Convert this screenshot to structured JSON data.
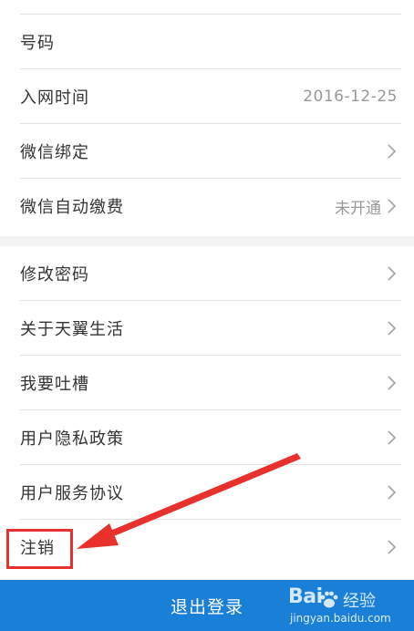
{
  "section1": {
    "rows": [
      {
        "label": "号码",
        "value": ""
      },
      {
        "label": "入网时间",
        "value": "2016-12-25"
      },
      {
        "label": "微信绑定",
        "value": ""
      },
      {
        "label": "微信自动缴费",
        "value": "未开通"
      }
    ]
  },
  "section2": {
    "rows": [
      {
        "label": "修改密码"
      },
      {
        "label": "关于天翼生活"
      },
      {
        "label": "我要吐槽"
      },
      {
        "label": "用户隐私政策"
      },
      {
        "label": "用户服务协议"
      },
      {
        "label": "注销"
      }
    ]
  },
  "logout": {
    "label": "退出登录"
  },
  "annotation": {
    "highlight_color": "#e8302c"
  },
  "watermark": {
    "brand_left": "Bai",
    "brand_right": "经验",
    "site": "jingyan.baidu.com"
  },
  "colors": {
    "accent": "#1a7fd7",
    "label": "#333333",
    "value": "#999999"
  }
}
